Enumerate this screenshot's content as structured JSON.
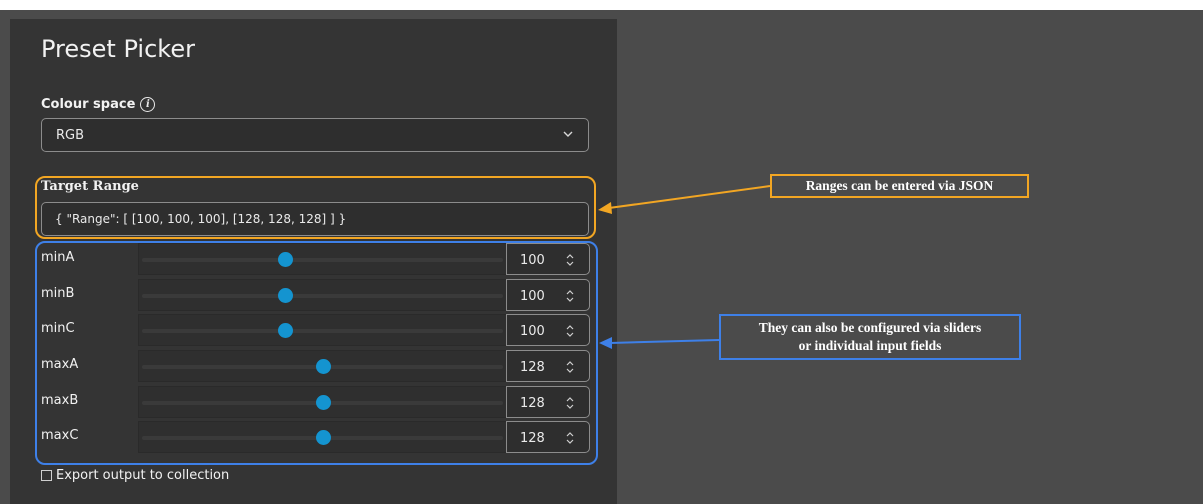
{
  "panel": {
    "title": "Preset Picker",
    "colour_space": {
      "label": "Colour space",
      "info_icon": "info-icon",
      "value": "RGB",
      "chevron_icon": "chevron-down-icon"
    },
    "target_range": {
      "label": "Target Range",
      "value": "{ \"Range\": [ [100, 100, 100], [128, 128, 128] ] }"
    },
    "sliders": [
      {
        "label": "minA",
        "value": "100",
        "fraction": 0.399
      },
      {
        "label": "minB",
        "value": "100",
        "fraction": 0.399
      },
      {
        "label": "minC",
        "value": "100",
        "fraction": 0.399
      },
      {
        "label": "maxA",
        "value": "128",
        "fraction": 0.502
      },
      {
        "label": "maxB",
        "value": "128",
        "fraction": 0.502
      },
      {
        "label": "maxC",
        "value": "128",
        "fraction": 0.502
      }
    ],
    "export": {
      "label": "Export output to collection",
      "checked": false
    }
  },
  "annotations": {
    "json_callout": "Ranges can be entered via JSON",
    "sliders_callout_line1": "They can also be configured via sliders",
    "sliders_callout_line2": "or individual input fields"
  },
  "colors": {
    "panel_bg": "#343434",
    "canvas_bg": "#4b4b4b",
    "slider_thumb": "#1494d0",
    "json_highlight": "#f2a623",
    "slider_highlight": "#3e80e8"
  }
}
